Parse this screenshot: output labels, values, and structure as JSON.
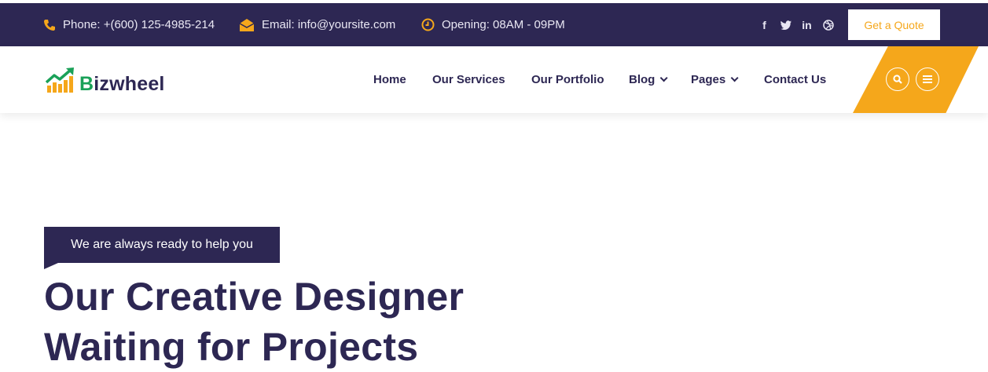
{
  "topbar": {
    "phone": "Phone: +(600) 125-4985-214",
    "email": "Email: info@yoursite.com",
    "opening": "Opening: 08AM - 09PM",
    "social": [
      {
        "icon": "facebook-icon",
        "glyph": "f"
      },
      {
        "icon": "twitter-icon",
        "glyph": "t"
      },
      {
        "icon": "linkedin-icon",
        "glyph": "in"
      },
      {
        "icon": "dribbble-icon",
        "glyph": "⊛"
      }
    ],
    "quote_label": "Get a Quote"
  },
  "brand": {
    "logo_prefix": "B",
    "logo_rest": "izwheel"
  },
  "nav": {
    "items": [
      {
        "label": "Home",
        "has_dropdown": false
      },
      {
        "label": "Our Services",
        "has_dropdown": false
      },
      {
        "label": "Our Portfolio",
        "has_dropdown": false
      },
      {
        "label": "Blog",
        "has_dropdown": true
      },
      {
        "label": "Pages",
        "has_dropdown": true
      },
      {
        "label": "Contact Us",
        "has_dropdown": false
      }
    ]
  },
  "hero": {
    "badge": "We are always ready to help you",
    "title_line1": "Our Creative Designer",
    "title_line2": "Waiting for Projects"
  },
  "colors": {
    "primary": "#2d2753",
    "accent": "#f5a71b",
    "brand_green": "#1aa158"
  }
}
